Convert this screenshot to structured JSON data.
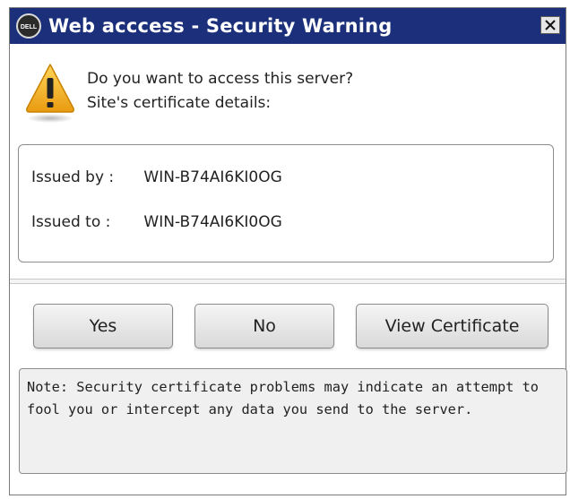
{
  "window": {
    "title": "Web acccess - Security Warning",
    "app_icon": "dell-logo-icon",
    "close_icon": "close-icon",
    "colors": {
      "titlebar": "#1b2f7a",
      "warning": "#f2b01e"
    }
  },
  "prompt": {
    "icon": "warning-icon",
    "question": "Do you want to access this server?",
    "subheading": "Site's certificate details:"
  },
  "certificate": {
    "issued_by_label": "Issued by :",
    "issued_by_value": "WIN-B74AI6KI0OG",
    "issued_to_label": "Issued to :",
    "issued_to_value": "WIN-B74AI6KI0OG"
  },
  "buttons": {
    "yes": "Yes",
    "no": "No",
    "view_certificate": "View Certificate"
  },
  "note": {
    "text": "Note: Security certificate problems may indicate an attempt to fool you or intercept any data you send to the server."
  }
}
